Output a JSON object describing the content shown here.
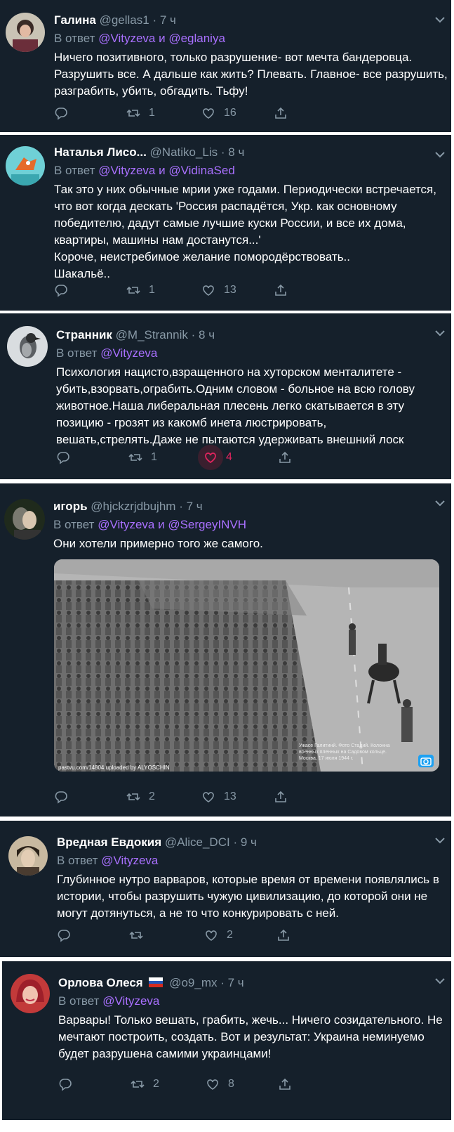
{
  "reply_prefix": "В ответ",
  "tweets": [
    {
      "name": "Галина",
      "handle": "@gellas1",
      "time": "· 7 ч",
      "reply_to": "@Vityzeva и @eglaniya",
      "lines": [
        "Ничего позитивного, только разрушение- вот мечта бандеровца.",
        "Разрушить все. А дальше как жить? Плевать. Главное- все разрушить,",
        "разграбить, убить, обгадить. Тьфу!"
      ],
      "retweets": "1",
      "likes": "16"
    },
    {
      "name": "Наталья Лисо...",
      "handle": "@Natiko_Lis",
      "time": "· 8 ч",
      "reply_to": "@Vityzeva и @VidinaSed",
      "lines": [
        "Так это у них обычные мрии уже годами. Периодически встречается,",
        "что вот когда дескать 'Россия распадётся, Укр. как основному",
        "победителю, дадут самые лучшие куски России, и все их дома,",
        "квартиры, машины нам достанутся...'",
        "Короче, неистребимое желание помородёрствовать..",
        "Шакальё.."
      ],
      "retweets": "1",
      "likes": "13"
    },
    {
      "name": "Странник",
      "handle": "@M_Strannik",
      "time": "· 8 ч",
      "reply_to": "@Vityzeva",
      "lines": [
        "Психология нацисто,взращенного на хуторском менталитете -",
        "убить,взорвать,ограбить.Одним словом - больное на всю голову",
        "животное.Наша либеральная плесень легко скатывается в эту",
        "позицию - грозят из какомб инета люстрировать,",
        "вешать,стрелять.Даже не пытаются удерживать внешний лоск"
      ],
      "retweets": "1",
      "likes": "4"
    },
    {
      "name": "игорь",
      "handle": "@hjckzrjdbujhm",
      "time": "· 7 ч",
      "reply_to": "@Vityzeva и @SergeyINVH",
      "lines": [
        "Они хотели примерно того же самого."
      ],
      "media_caption": "pastvu.com/14804  uploaded by ALYOSCHIN",
      "media_photo_text": "Ужасе Галитинй. Фото Стадий. Колонна военных пленных на Садовом кольце. Москва, 17 июля 1944 г.",
      "retweets": "2",
      "likes": "13"
    },
    {
      "name": "Вредная Евдокия",
      "handle": "@Alice_DCI",
      "time": "· 9 ч",
      "reply_to": "@Vityzeva",
      "lines": [
        "Глубинное нутро варваров, которые время от времени появлялись в",
        "истории, чтобы разрушить чужую цивилизацию, до которой они не",
        "могут дотянуться, а не то что конкурировать с ней."
      ],
      "retweets": "",
      "likes": "2"
    },
    {
      "name": "Орлова Олеся",
      "handle": "@o9_mx",
      "time": "· 7 ч",
      "reply_to": "@Vityzeva",
      "lines": [
        "Варвары! Только вешать, грабить, жечь... Ничего созидательного. Не",
        "мечтают построить, создать. Вот и результат: Украина неминуемо",
        "будет разрушена самими украинцами!"
      ],
      "retweets": "2",
      "likes": "8"
    }
  ],
  "colors": {
    "background": "#15202b",
    "muted": "#8899a6",
    "link": "#a970ff",
    "like_active": "#e0245e"
  },
  "icons": [
    "chevron-down-icon",
    "reply-icon",
    "retweet-icon",
    "like-icon",
    "share-icon",
    "camera-icon",
    "russia-flag-icon"
  ]
}
